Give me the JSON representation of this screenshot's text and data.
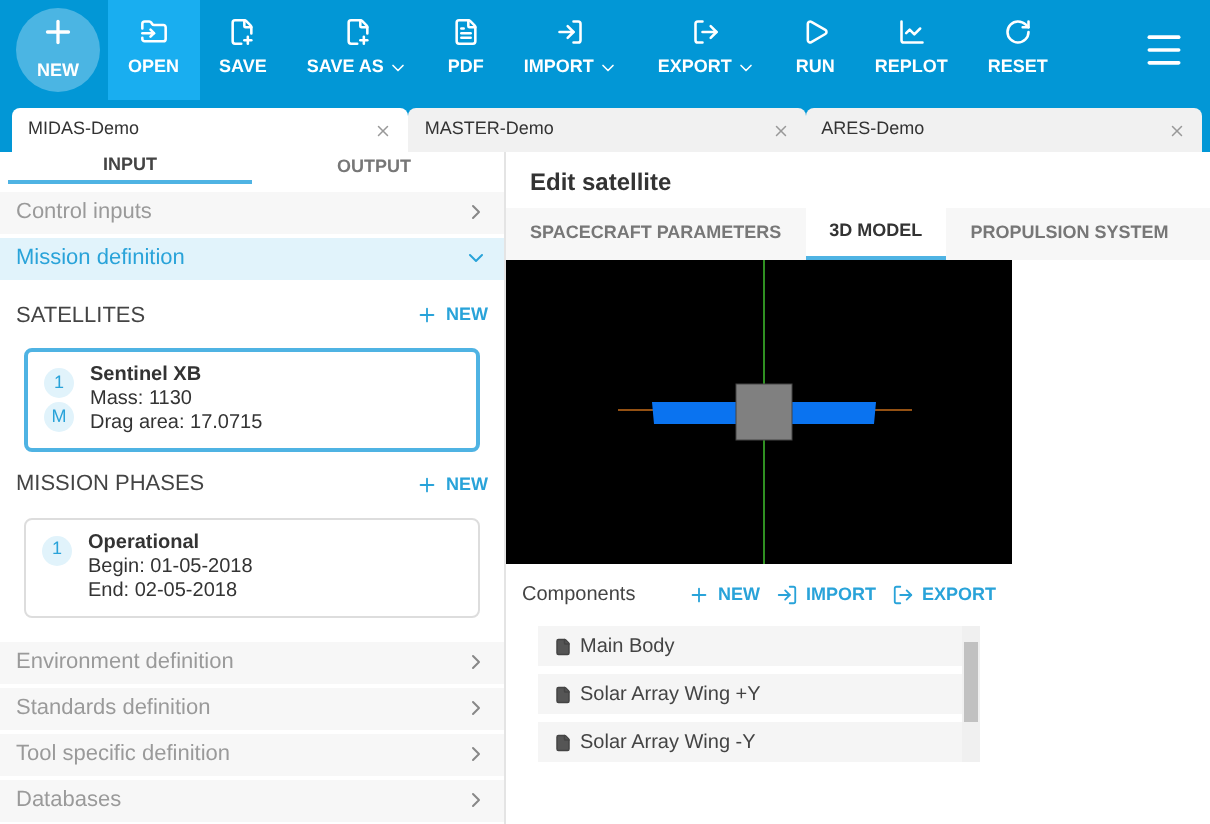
{
  "toolbar": {
    "buttons": [
      {
        "label": "NEW",
        "kind": "new",
        "selected": false,
        "dropdown": false
      },
      {
        "label": "OPEN",
        "kind": "open",
        "selected": true,
        "dropdown": false
      },
      {
        "label": "SAVE",
        "kind": "save",
        "selected": false,
        "dropdown": false
      },
      {
        "label": "SAVE AS",
        "kind": "save",
        "selected": false,
        "dropdown": true
      },
      {
        "label": "PDF",
        "kind": "pdf",
        "selected": false,
        "dropdown": false
      },
      {
        "label": "IMPORT",
        "kind": "import",
        "selected": false,
        "dropdown": true
      },
      {
        "label": "EXPORT",
        "kind": "export",
        "selected": false,
        "dropdown": true
      },
      {
        "label": "RUN",
        "kind": "run",
        "selected": false,
        "dropdown": false
      },
      {
        "label": "REPLOT",
        "kind": "replot",
        "selected": false,
        "dropdown": false
      },
      {
        "label": "RESET",
        "kind": "reset",
        "selected": false,
        "dropdown": false
      }
    ]
  },
  "doc_tabs": [
    {
      "label": "MIDAS-Demo",
      "selected": true
    },
    {
      "label": "MASTER-Demo",
      "selected": false
    },
    {
      "label": "ARES-Demo",
      "selected": false
    }
  ],
  "left_tabs": [
    {
      "label": "INPUT",
      "selected": true
    },
    {
      "label": "OUTPUT",
      "selected": false
    }
  ],
  "sections_top": [
    {
      "label": "Control inputs",
      "expanded": false
    },
    {
      "label": "Mission definition",
      "expanded": true
    }
  ],
  "satellites": {
    "title": "SATELLITES",
    "new": "NEW",
    "items": [
      {
        "index": "1",
        "badge": "M",
        "name": "Sentinel XB",
        "lines": [
          "Mass: 1130",
          "Drag area: 17.0715"
        ],
        "selected": true
      }
    ]
  },
  "phases": {
    "title": "MISSION PHASES",
    "new": "NEW",
    "items": [
      {
        "index": "1",
        "name": "Operational",
        "lines": [
          "Begin: 01-05-2018",
          "End: 02-05-2018"
        ],
        "selected": false
      }
    ]
  },
  "sections_bottom": [
    {
      "label": "Environment definition",
      "expanded": false
    },
    {
      "label": "Standards definition",
      "expanded": false
    },
    {
      "label": "Tool specific definition",
      "expanded": false
    },
    {
      "label": "Databases",
      "expanded": false
    }
  ],
  "editor": {
    "title": "Edit satellite",
    "tabs": [
      {
        "label": "SPACECRAFT PARAMETERS",
        "selected": false
      },
      {
        "label": "3D MODEL",
        "selected": true
      },
      {
        "label": "PROPULSION SYSTEM",
        "selected": false
      }
    ],
    "components": {
      "title": "Components",
      "actions": [
        {
          "label": "NEW",
          "kind": "new"
        },
        {
          "label": "IMPORT",
          "kind": "import"
        },
        {
          "label": "EXPORT",
          "kind": "export"
        }
      ],
      "items": [
        "Main Body",
        "Solar Array Wing +Y",
        "Solar Array Wing -Y"
      ]
    }
  }
}
